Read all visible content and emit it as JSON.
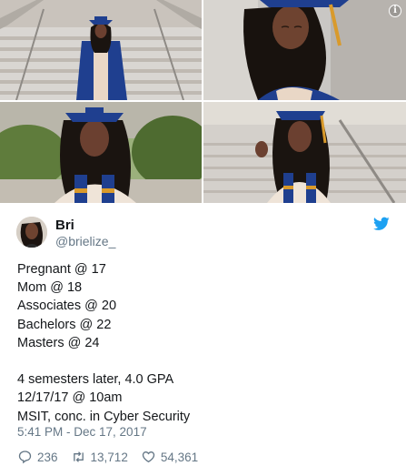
{
  "tweet": {
    "display_name": "Bri",
    "handle": "@brielize_",
    "lines": [
      "Pregnant @ 17",
      "Mom @ 18",
      "Associates @ 20",
      "Bachelors @ 22",
      "Masters @ 24",
      "",
      "4 semesters later, 4.0 GPA",
      "12/17/17 @ 10am",
      "MSIT, conc. in Cyber Security"
    ],
    "timestamp": "5:41 PM - Dec 17, 2017",
    "replies": "236",
    "retweets": "13,712",
    "likes": "54,361"
  },
  "photos": {
    "info_badge": "i"
  },
  "colors": {
    "text": "#14171a",
    "muted": "#657786",
    "twitter_blue": "#1da1f2",
    "gown_blue": "#1f3f8f",
    "tassel_gold": "#d99a2b"
  },
  "icons": {
    "platform": "twitter-bird-icon",
    "reply": "reply-icon",
    "retweet": "retweet-icon",
    "like": "heart-icon",
    "info": "info-icon"
  }
}
